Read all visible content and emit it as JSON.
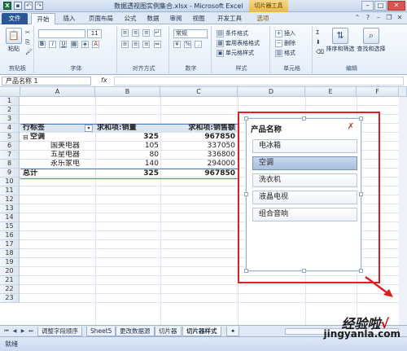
{
  "window": {
    "title": "数据透视图实例集合.xlsx - Microsoft Excel",
    "context_tab": "切片器工具"
  },
  "ribbon_tabs": [
    "文件",
    "开始",
    "插入",
    "页面布局",
    "公式",
    "数据",
    "审阅",
    "视图",
    "开发工具",
    "选项"
  ],
  "ribbon": {
    "clipboard": {
      "paste": "粘贴",
      "label": "剪贴板"
    },
    "font": {
      "label": "字体",
      "size": "11"
    },
    "alignment": {
      "label": "对齐方式"
    },
    "number": {
      "format": "常规",
      "label": "数字"
    },
    "styles": {
      "conditional": "条件格式",
      "table": "套用表格格式",
      "cell": "单元格样式",
      "label": "样式"
    },
    "cells": {
      "insert": "插入",
      "delete": "删除",
      "format": "格式",
      "label": "单元格"
    },
    "editing": {
      "sort": "排序和筛选",
      "find": "查找和选择",
      "label": "编辑"
    }
  },
  "formula_bar": {
    "name_box": "产品名称 1",
    "fx": "fx",
    "value": ""
  },
  "columns": [
    "A",
    "B",
    "C",
    "D",
    "E",
    "F"
  ],
  "rows": [
    "1",
    "2",
    "3",
    "4",
    "5",
    "6",
    "7",
    "8",
    "9",
    "10",
    "11",
    "12",
    "13",
    "14",
    "15",
    "16",
    "17",
    "18",
    "19",
    "20",
    "21",
    "22",
    "23"
  ],
  "pivot": {
    "headers": {
      "row_label": "行标签",
      "qty": "求和项:销量",
      "sales": "求和项:销售额"
    },
    "group": {
      "name": "空调",
      "qty": "325",
      "sales": "967850"
    },
    "items": [
      {
        "name": "国美电器",
        "qty": "105",
        "sales": "337050"
      },
      {
        "name": "五星电器",
        "qty": "80",
        "sales": "336800"
      },
      {
        "name": "永乐家电",
        "qty": "140",
        "sales": "294000"
      }
    ],
    "total": {
      "label": "总计",
      "qty": "325",
      "sales": "967850"
    }
  },
  "slicer": {
    "title": "产品名称",
    "items": [
      {
        "label": "电冰箱",
        "selected": false
      },
      {
        "label": "空调",
        "selected": true
      },
      {
        "label": "洗衣机",
        "selected": false
      },
      {
        "label": "液晶电视",
        "selected": false
      },
      {
        "label": "组合音响",
        "selected": false
      }
    ]
  },
  "sheet_tabs": [
    "调整字段顺序",
    "Sheet5",
    "更改数据源",
    "切片器",
    "切片器样式"
  ],
  "active_sheet": "切片器样式",
  "status": {
    "text": "就绪"
  },
  "watermark": {
    "brand": "经验啦",
    "url": "jingyanla.com",
    "check": "√"
  },
  "colors": {
    "accent": "#2b5797",
    "annotation": "#e02020",
    "slicer_selected": "#a9c0de"
  }
}
